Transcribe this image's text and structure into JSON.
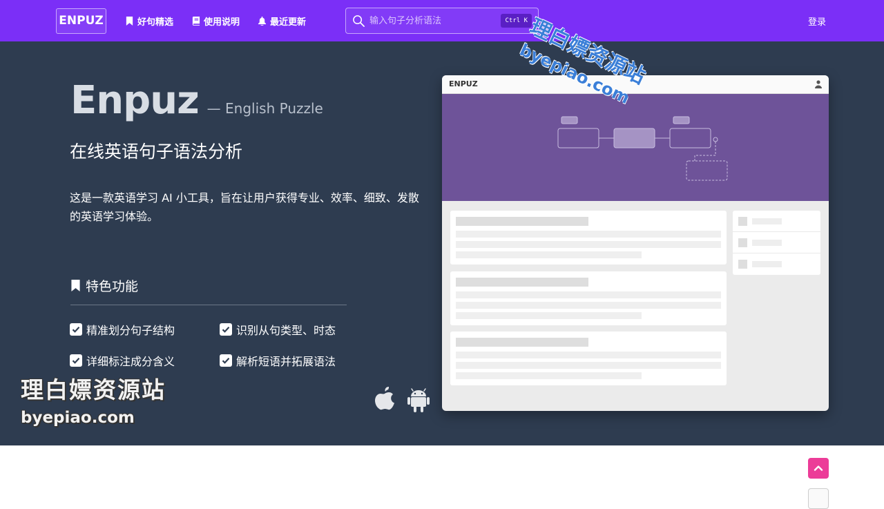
{
  "navbar": {
    "brand": "ENPUZ",
    "items": [
      {
        "label": "好句精选",
        "icon": "bookmark-icon"
      },
      {
        "label": "使用说明",
        "icon": "book-icon"
      },
      {
        "label": "最近更新",
        "icon": "bell-icon"
      }
    ],
    "search": {
      "placeholder": "输入句子分析语法",
      "shortcut": "Ctrl K",
      "icon": "search-icon"
    },
    "login_label": "登录",
    "color": "#7b2ff7"
  },
  "hero": {
    "title": "Enpuz",
    "title_suffix": "— English Puzzle",
    "subtitle": "在线英语句子语法分析",
    "description": "这是一款英语学习 AI 小工具，旨在让用户获得专业、效率、细致、发散的英语学习体验。",
    "features_heading": "特色功能",
    "features": [
      "精准划分句子结构",
      "识别从句类型、时态",
      "详细标注成分含义",
      "解析短语并拓展语法"
    ],
    "platforms": [
      "apple-icon",
      "android-icon"
    ],
    "background": "#2e3c50"
  },
  "mock_window": {
    "title": "ENPUZ",
    "user_icon": "user-icon",
    "banner_color": "#6e5399"
  },
  "watermark": {
    "cn": "理白嫖资源站",
    "url": "byepiao.com"
  },
  "back_to_top": {
    "icon": "chevron-up-icon",
    "color": "#ec3c98"
  }
}
